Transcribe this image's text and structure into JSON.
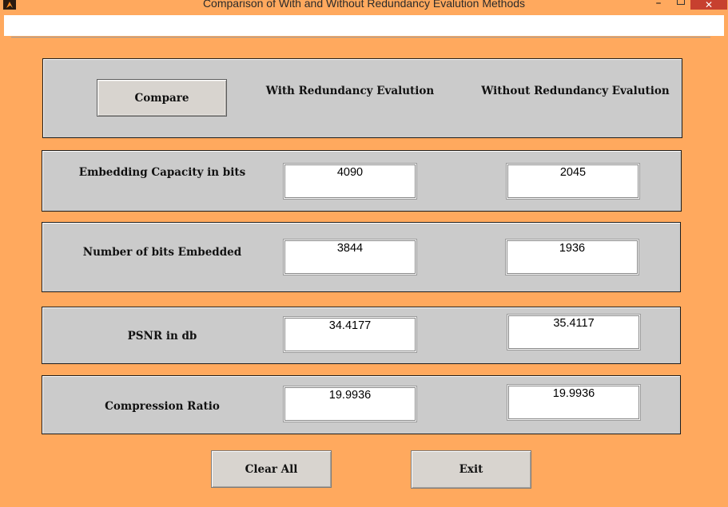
{
  "window": {
    "title": "Comparison of With and Without Redundancy Evalution Methods",
    "minimize_glyph": "–",
    "close_glyph": "✕",
    "icon": "matlab-icon"
  },
  "colors": {
    "figure_bg": "#ffa95e",
    "panel_bg": "#cbcbcb",
    "button_bg": "#d8d4cf",
    "close_bg": "#c7402f"
  },
  "header": {
    "compare_label": "Compare",
    "with_label": "With Redundancy Evalution",
    "without_label": "Without Redundancy Evalution"
  },
  "rows": [
    {
      "label": "Embedding Capacity in bits",
      "with_value": "4090",
      "without_value": "2045"
    },
    {
      "label": "Number of bits Embedded",
      "with_value": "3844",
      "without_value": "1936"
    },
    {
      "label": "PSNR in db",
      "with_value": "34.4177",
      "without_value": "35.4117"
    },
    {
      "label": "Compression Ratio",
      "with_value": "19.9936",
      "without_value": "19.9936"
    }
  ],
  "actions": {
    "clear_label": "Clear All",
    "exit_label": "Exit"
  }
}
